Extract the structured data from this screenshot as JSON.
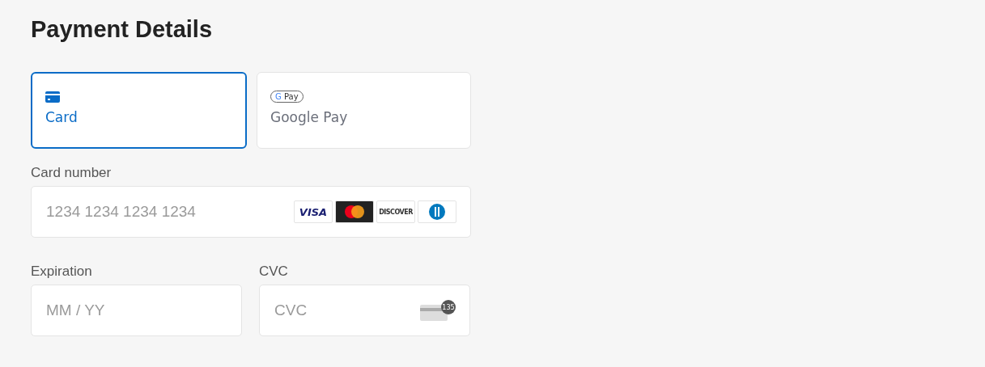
{
  "title": "Payment Details",
  "methods": [
    {
      "kind": "card",
      "label": "Card",
      "selected": true
    },
    {
      "kind": "gpay",
      "label": "Google Pay",
      "badge_g": "G",
      "badge_text": "Pay",
      "selected": false
    }
  ],
  "card_number": {
    "label": "Card number",
    "placeholder": "1234 1234 1234 1234",
    "brands": [
      {
        "kind": "visa",
        "text": "VISA"
      },
      {
        "kind": "mastercard"
      },
      {
        "kind": "discover",
        "text": "DISCOVER"
      },
      {
        "kind": "diners"
      }
    ]
  },
  "expiration": {
    "label": "Expiration",
    "placeholder": "MM / YY"
  },
  "cvc": {
    "label": "CVC",
    "placeholder": "CVC",
    "icon_text": "135"
  }
}
